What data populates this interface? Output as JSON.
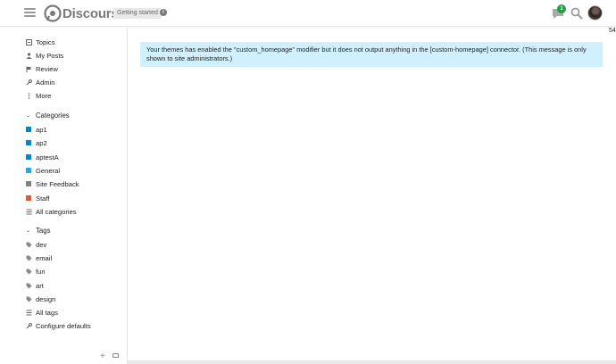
{
  "header": {
    "logo_text": "Discourse",
    "getting_started": "Getting started",
    "notification_count": "1"
  },
  "sidebar": {
    "primary": [
      {
        "label": "Topics",
        "icon": "topics-icon"
      },
      {
        "label": "My Posts",
        "icon": "user-icon"
      },
      {
        "label": "Review",
        "icon": "flag-icon"
      },
      {
        "label": "Admin",
        "icon": "wrench-icon"
      },
      {
        "label": "More",
        "icon": "more-vertical-icon"
      }
    ],
    "categories_title": "Categories",
    "categories": [
      {
        "label": "ap1",
        "color": "#0088cc"
      },
      {
        "label": "ap2",
        "color": "#0088cc"
      },
      {
        "label": "aptestA",
        "color": "#0088cc"
      },
      {
        "label": "General",
        "color": "#25aae2"
      },
      {
        "label": "Site Feedback",
        "color": "#808281"
      },
      {
        "label": "Staff",
        "color": "#e45735"
      }
    ],
    "all_categories": "All categories",
    "tags_title": "Tags",
    "tags": [
      "dev",
      "email",
      "fun",
      "art",
      "design"
    ],
    "all_tags": "All tags",
    "configure_defaults": "Configure defaults"
  },
  "main": {
    "banner": "Your themes has enabled the \"custom_homepage\" modifier but it does not output anything in the [custom-homepage] connector. (This message is only shown to site administrators.)",
    "right_number": "54"
  }
}
